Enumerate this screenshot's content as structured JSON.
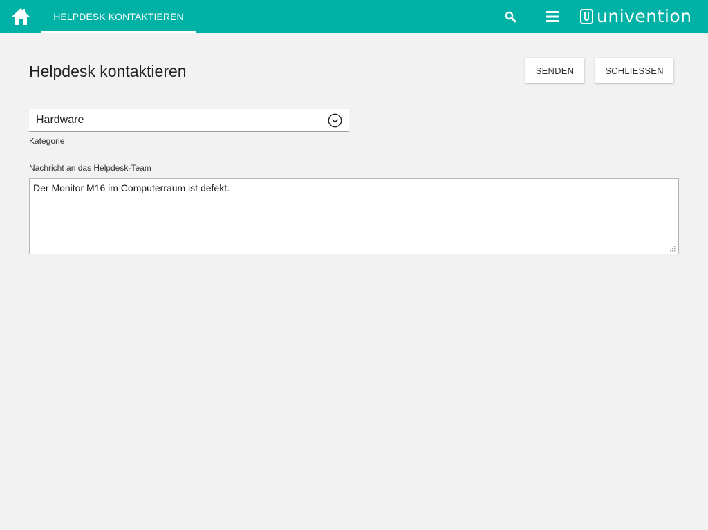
{
  "header": {
    "active_tab": "HELPDESK KONTAKTIEREN",
    "brand": "univention",
    "icons": [
      "home-icon",
      "search-icon",
      "menu-icon",
      "univention-logo-icon"
    ],
    "color": "#00b1a6"
  },
  "main": {
    "title": "Helpdesk kontaktieren",
    "buttons": {
      "send_label": "SENDEN",
      "close_label": "SCHLIESSEN"
    },
    "category": {
      "value": "Hardware",
      "label": "Kategorie"
    },
    "message": {
      "label": "Nachricht an das Helpdesk-Team",
      "value": "Der Monitor M16 im Computerraum ist defekt."
    }
  }
}
